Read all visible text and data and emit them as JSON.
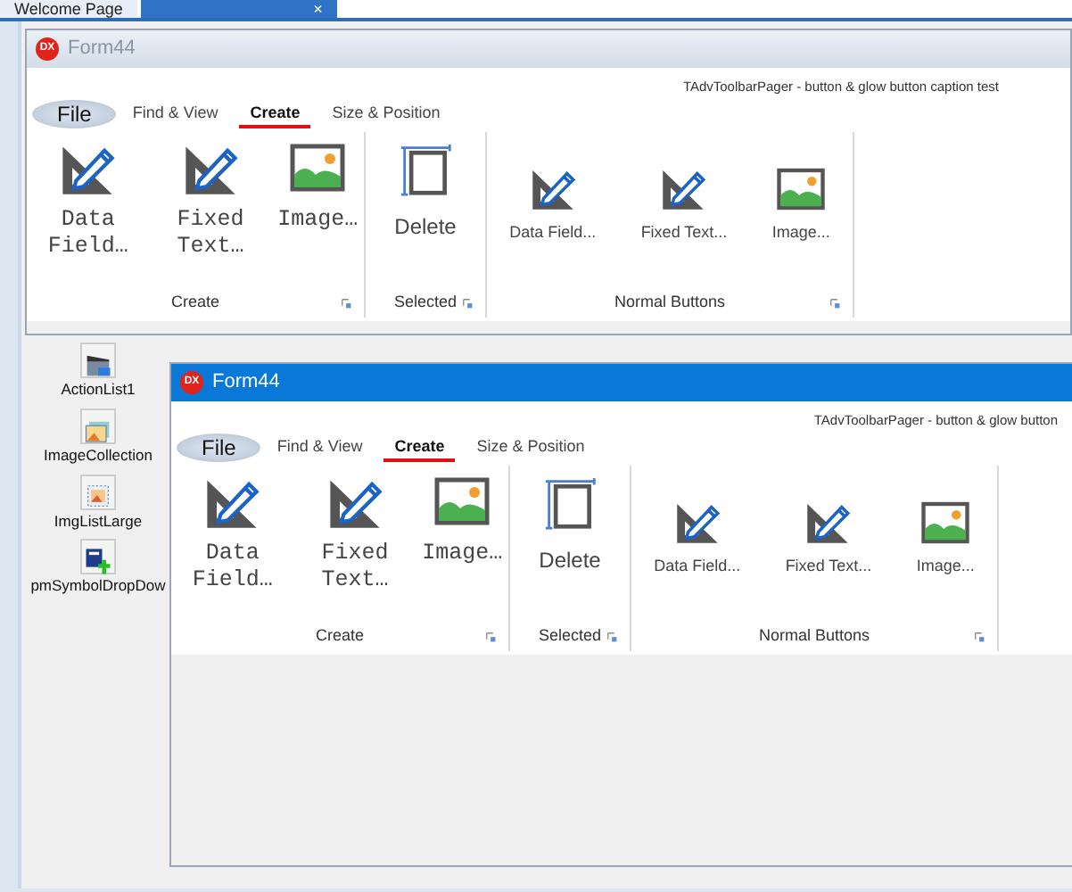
{
  "ide_tabs": [
    {
      "label": "Welcome Page",
      "selected": false
    },
    {
      "selected": true,
      "close": "×"
    }
  ],
  "forms": [
    {
      "logo": "DX",
      "title": "Form44",
      "active": false,
      "caption": "TAdvToolbarPager - button & glow button caption test",
      "file_button": "File",
      "tabs": [
        {
          "label": "Find & View",
          "selected": false
        },
        {
          "label": "Create",
          "selected": true
        },
        {
          "label": "Size & Position",
          "selected": false
        }
      ],
      "groups": [
        {
          "label": "Create",
          "buttons": [
            {
              "kind": "mono",
              "label": "Data Field…"
            },
            {
              "kind": "mono",
              "label": "Fixed Text…"
            },
            {
              "kind": "mono",
              "label": "Image…"
            }
          ]
        },
        {
          "label": "Selected",
          "buttons": [
            {
              "kind": "large",
              "label": "Delete"
            }
          ]
        },
        {
          "label": "Normal Buttons",
          "buttons": [
            {
              "kind": "small",
              "label": "Data Field..."
            },
            {
              "kind": "small",
              "label": "Fixed Text..."
            },
            {
              "kind": "small",
              "label": "Image..."
            }
          ]
        }
      ]
    },
    {
      "logo": "DX",
      "title": "Form44",
      "active": true,
      "caption": "TAdvToolbarPager - button & glow button",
      "file_button": "File",
      "tabs": [
        {
          "label": "Find & View",
          "selected": false
        },
        {
          "label": "Create",
          "selected": true
        },
        {
          "label": "Size & Position",
          "selected": false
        }
      ],
      "groups": [
        {
          "label": "Create",
          "buttons": [
            {
              "kind": "mono",
              "label": "Data Field…"
            },
            {
              "kind": "mono",
              "label": "Fixed Text…"
            },
            {
              "kind": "mono",
              "label": "Image…"
            }
          ]
        },
        {
          "label": "Selected",
          "buttons": [
            {
              "kind": "large",
              "label": "Delete"
            }
          ]
        },
        {
          "label": "Normal Buttons",
          "buttons": [
            {
              "kind": "small",
              "label": "Data Field..."
            },
            {
              "kind": "small",
              "label": "Fixed Text..."
            },
            {
              "kind": "small",
              "label": "Image..."
            }
          ]
        }
      ]
    }
  ],
  "components": [
    {
      "label": "ActionList1"
    },
    {
      "label": "ImageCollection"
    },
    {
      "label": "ImgListLarge"
    },
    {
      "label": "pmSymbolDropDow"
    }
  ]
}
